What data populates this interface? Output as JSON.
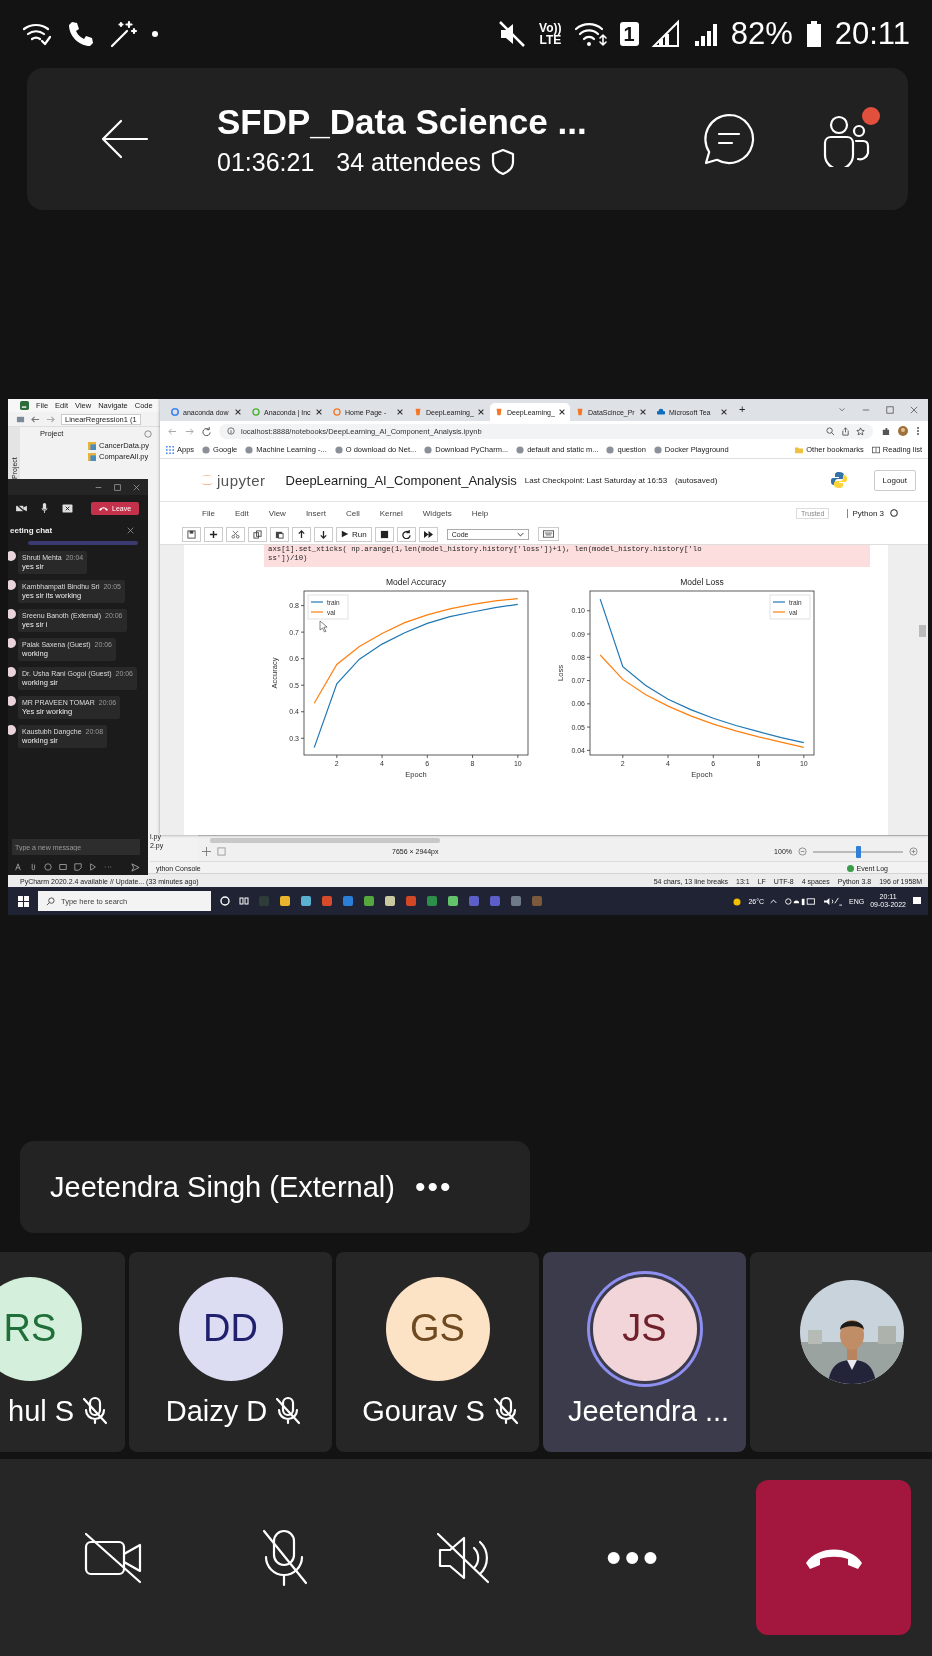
{
  "status_bar": {
    "volte": [
      "Vo))",
      "LTE"
    ],
    "sim_slot": "1",
    "battery": "82%",
    "time": "20:11"
  },
  "meeting": {
    "title": "SFDP_Data Science ...",
    "duration": "01:36:21",
    "attendees": "34 attendees",
    "people_alert": true
  },
  "shared_screen": {
    "pycharm": {
      "menu": [
        "File",
        "Edit",
        "View",
        "Navigate",
        "Code"
      ],
      "breadcrumb": "LinearRegression1 (1",
      "side_tab": "Project",
      "project_label": "Project",
      "files": [
        "CancerData.py",
        "CompareAll.py"
      ],
      "file_fragments": [
        "l.py",
        "2.py"
      ],
      "image_size": "7656 × 2944px",
      "zoom": "100%",
      "zoom_slider": {
        "level": 0.5
      },
      "console_tab": "ython Console",
      "event_log": "Event Log",
      "update_notice": "PyCharm 2020.2.4 available // Update... (33 minutes ago)",
      "status_items": [
        "54 chars, 13 line breaks",
        "13:1",
        "LF",
        "UTF-8",
        "4 spaces",
        "Python 3.8",
        "196 of 1958M"
      ]
    },
    "browser": {
      "tabs": [
        {
          "label": "anaconda dow",
          "kind": "google",
          "selected": false
        },
        {
          "label": "Anaconda | Inc",
          "kind": "anaconda",
          "selected": false
        },
        {
          "label": "Home Page - ",
          "kind": "home",
          "selected": false
        },
        {
          "label": "DeepLearning_",
          "kind": "jupyter",
          "selected": false
        },
        {
          "label": "DeepLearning_",
          "kind": "jupyter",
          "selected": true
        },
        {
          "label": "DataScince_Pr",
          "kind": "jupyter",
          "selected": false
        },
        {
          "label": "Microsoft Tea",
          "kind": "cloud",
          "selected": false
        }
      ],
      "new_tab": "+",
      "url": "localhost:8888/notebooks/DeepLearning_AI_Component_Analysis.ipynb",
      "bookmarks": [
        "Apps",
        "Google",
        "Machine Learning -...",
        "O download do Net...",
        "Download PyCharm...",
        "default and static m...",
        "question",
        "Docker Playground"
      ],
      "other_bookmarks": "Other bookmarks",
      "reading_list": "Reading list"
    },
    "jupyter": {
      "logo_text": "jupyter",
      "notebook": "DeepLearning_AI_Component_Analysis",
      "checkpoint": "Last Checkpoint: Last Saturday at 16:53",
      "autosaved": "(autosaved)",
      "logout": "Logout",
      "menu": [
        "File",
        "Edit",
        "View",
        "Insert",
        "Cell",
        "Kernel",
        "Widgets",
        "Help"
      ],
      "trusted": "Trusted",
      "kernel": "Python 3",
      "run": "Run",
      "cell_type": "Code",
      "code": [
        "axs[1].set_xticks( np.arange(1,len(model_history.history['loss'])+1), len(model_history.history['lo",
        "ss'])/10)"
      ],
      "charts": [
        {
          "chart_data": {
            "type": "line",
            "title": "Model Accuracy",
            "xlabel": "Epoch",
            "ylabel": "Accuracy",
            "x": [
              1,
              2,
              3,
              4,
              5,
              6,
              7,
              8,
              9,
              10
            ],
            "series": [
              {
                "name": "train",
                "color": "#1f77b4",
                "values": [
                  0.265,
                  0.505,
                  0.598,
                  0.655,
                  0.698,
                  0.733,
                  0.758,
                  0.776,
                  0.792,
                  0.805
                ]
              },
              {
                "name": "val",
                "color": "#ff7f0e",
                "values": [
                  0.432,
                  0.578,
                  0.646,
                  0.695,
                  0.736,
                  0.765,
                  0.788,
                  0.805,
                  0.818,
                  0.826
                ]
              }
            ],
            "xlim": [
              0.55,
              10.45
            ],
            "ylim": [
              0.237,
              0.855
            ],
            "xticks": [
              2,
              4,
              6,
              8,
              10
            ],
            "yticks": [
              {
                "value": 0.3,
                "label": "0.3"
              },
              {
                "value": 0.4,
                "label": "0.4"
              },
              {
                "value": 0.5,
                "label": "0.5"
              },
              {
                "value": 0.6,
                "label": "0.6"
              },
              {
                "value": 0.7,
                "label": "0.7"
              },
              {
                "value": 0.8,
                "label": "0.8"
              }
            ],
            "legend": "upper left"
          }
        },
        {
          "chart_data": {
            "type": "line",
            "title": "Model Loss",
            "xlabel": "Epoch",
            "ylabel": "Loss",
            "x": [
              1,
              2,
              3,
              4,
              5,
              6,
              7,
              8,
              9,
              10
            ],
            "series": [
              {
                "name": "train",
                "color": "#1f77b4",
                "values": [
                  0.105,
                  0.076,
                  0.068,
                  0.062,
                  0.0575,
                  0.0538,
                  0.0507,
                  0.048,
                  0.0455,
                  0.0433
                ]
              },
              {
                "name": "val",
                "color": "#ff7f0e",
                "values": [
                  0.081,
                  0.0705,
                  0.064,
                  0.059,
                  0.0548,
                  0.0513,
                  0.0484,
                  0.0458,
                  0.0435,
                  0.0413
                ]
              }
            ],
            "xlim": [
              0.55,
              10.45
            ],
            "ylim": [
              0.038,
              0.1085
            ],
            "xticks": [
              2,
              4,
              6,
              8,
              10
            ],
            "yticks": [
              {
                "value": 0.04,
                "label": "0.04"
              },
              {
                "value": 0.05,
                "label": "0.05"
              },
              {
                "value": 0.06,
                "label": "0.06"
              },
              {
                "value": 0.07,
                "label": "0.07"
              },
              {
                "value": 0.08,
                "label": "0.08"
              },
              {
                "value": 0.09,
                "label": "0.09"
              },
              {
                "value": 0.1,
                "label": "0.10"
              }
            ],
            "legend": "upper right"
          }
        }
      ]
    },
    "teams_chat": {
      "leave": "Leave",
      "title": "eeting chat",
      "messages": [
        {
          "author": "Shruti Mehta",
          "time": "20:04",
          "text": "yes sir"
        },
        {
          "author": "Kambhampati Bindhu Sri",
          "time": "20:05",
          "text": "yes sir its working"
        },
        {
          "author": "Sreenu Banoth (External)",
          "time": "20:06",
          "text": "yes sir i"
        },
        {
          "author": "Palak Saxena (Guest)",
          "time": "20:06",
          "text": "working"
        },
        {
          "author": "Dr. Usha Rani Gogoi (Guest)",
          "time": "20:06",
          "text": "working sir"
        },
        {
          "author": "MR PRAVEEN TOMAR",
          "time": "20:06",
          "text": "Yes sir working"
        },
        {
          "author": "Kaustubh Dangche",
          "time": "20:08",
          "text": "working sir"
        }
      ],
      "placeholder": "Type a new message"
    },
    "taskbar": {
      "search_placeholder": "Type here to search",
      "weather": "26°C",
      "language": "ENG",
      "time": "20:11",
      "date": "09-03-2022"
    }
  },
  "speaker": {
    "name": "Jeetendra Singh (External)",
    "more": "•••"
  },
  "participants": [
    {
      "kind": "partial",
      "initials": "RS",
      "name": "hul S",
      "color": "#d4efdc",
      "muted": true,
      "selected": false
    },
    {
      "kind": "avatar",
      "initials": "DD",
      "name": "Daizy D",
      "color": "#dcdcf3",
      "muted": true,
      "selected": false
    },
    {
      "kind": "avatar",
      "initials": "GS",
      "name": "Gourav S",
      "color": "#fde3c6",
      "muted": true,
      "selected": false
    },
    {
      "kind": "avatar",
      "initials": "JS",
      "name": "Jeetendra ...",
      "color": "#f2d5d9",
      "muted": false,
      "selected": true
    },
    {
      "kind": "picture",
      "selected": false
    }
  ],
  "call_controls": [
    {
      "kind": "camera",
      "on": false
    },
    {
      "kind": "mic",
      "on": false
    },
    {
      "kind": "speaker",
      "on": false
    },
    {
      "kind": "more",
      "label": "•••"
    },
    {
      "kind": "hangup"
    }
  ]
}
